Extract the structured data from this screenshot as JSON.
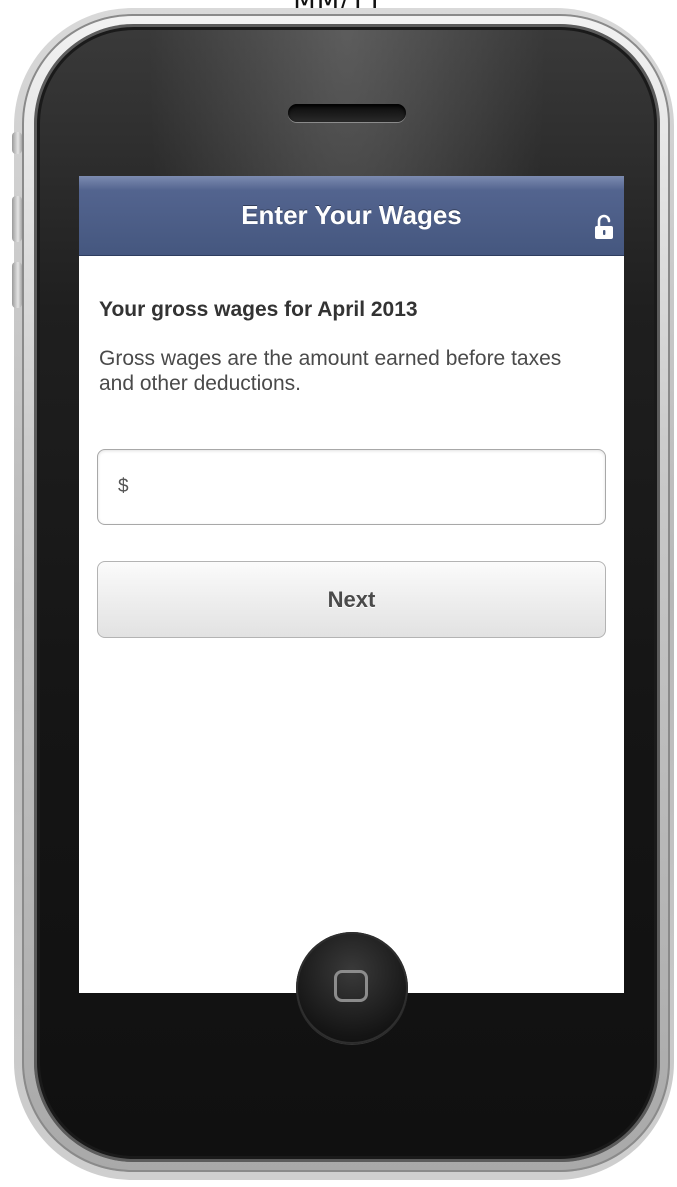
{
  "caption": "MM/YY",
  "header": {
    "title": "Enter Your Wages",
    "icon": "unlocked-lock-icon"
  },
  "content": {
    "heading": "Your gross wages for April 2013",
    "description": "Gross wages are the amount earned before taxes and other deductions.",
    "wage_input": {
      "placeholder": "$",
      "value": ""
    },
    "next_label": "Next"
  },
  "colors": {
    "header_bar": "#45577f",
    "header_text": "#ffffff",
    "body_text": "#333333"
  }
}
